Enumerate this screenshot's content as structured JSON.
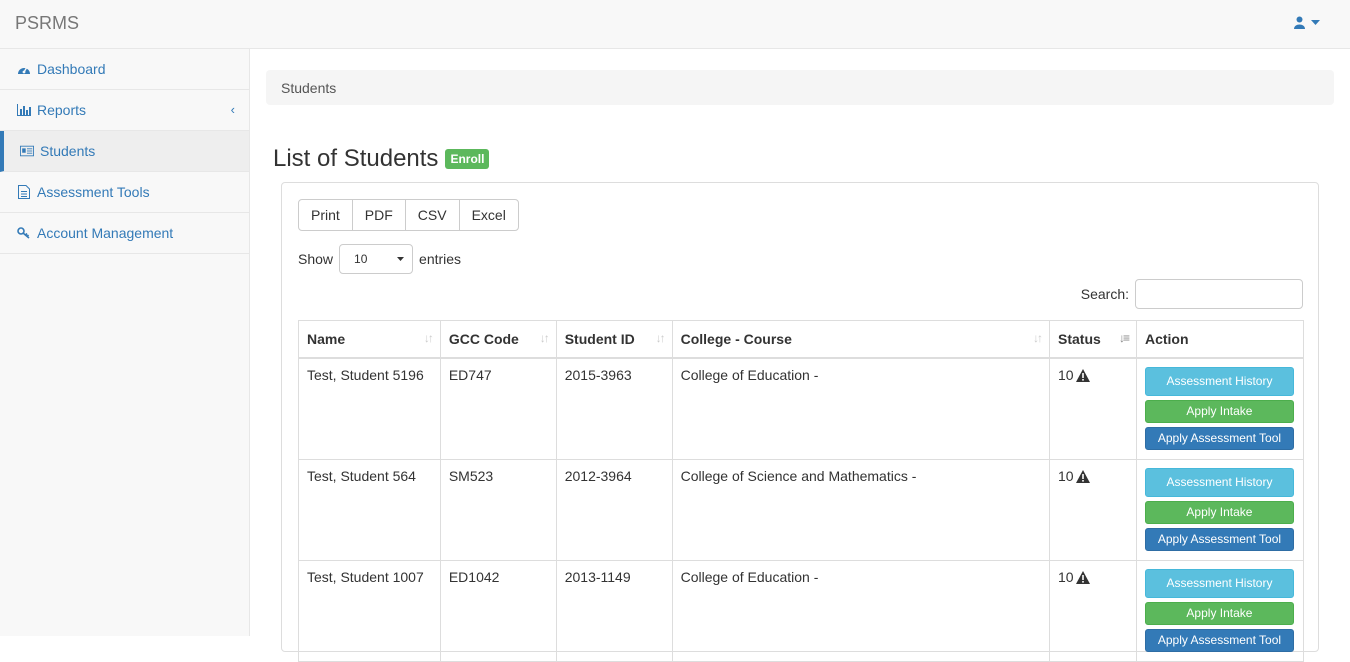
{
  "app": {
    "brand": "PSRMS"
  },
  "sidebar": {
    "items": [
      {
        "label": "Dashboard",
        "icon": "dashboard-icon"
      },
      {
        "label": "Reports",
        "icon": "bar-chart-icon"
      },
      {
        "label": "Students",
        "icon": "id-card-icon"
      },
      {
        "label": "Assessment Tools",
        "icon": "document-icon"
      },
      {
        "label": "Account Management",
        "icon": "key-icon"
      }
    ]
  },
  "breadcrumb": "Students",
  "page": {
    "title": "List of Students",
    "enroll_label": "Enroll"
  },
  "export_buttons": [
    "Print",
    "PDF",
    "CSV",
    "Excel"
  ],
  "length": {
    "show": "Show",
    "value": "10",
    "entries": "entries"
  },
  "search": {
    "label": "Search:"
  },
  "table": {
    "headers": [
      "Name",
      "GCC Code",
      "Student ID",
      "College - Course",
      "Status",
      "Action"
    ],
    "rows": [
      {
        "name": "Test, Student 5196",
        "gcc": "ED747",
        "sid": "2015-3963",
        "college": "College of Education -",
        "status": "10"
      },
      {
        "name": "Test, Student 564",
        "gcc": "SM523",
        "sid": "2012-3964",
        "college": "College of Science and Mathematics -",
        "status": "10"
      },
      {
        "name": "Test, Student 1007",
        "gcc": "ED1042",
        "sid": "2013-1149",
        "college": "College of Education -",
        "status": "10"
      }
    ],
    "actions": [
      "Assessment History",
      "Apply Intake",
      "Apply Assessment Tool"
    ]
  },
  "colors": {
    "primary": "#337ab7",
    "success": "#5cb85c",
    "info": "#5bc0de"
  }
}
